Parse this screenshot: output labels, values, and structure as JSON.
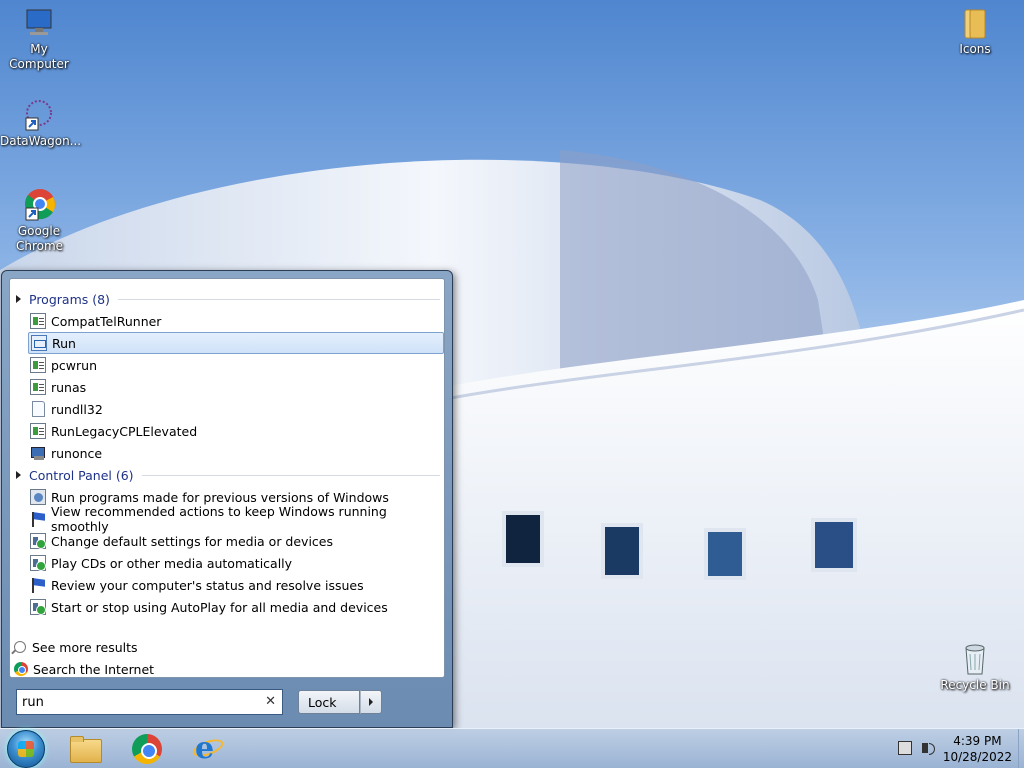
{
  "desktop": {
    "icons": [
      {
        "label": "My Computer"
      },
      {
        "label": "DataWagon..."
      },
      {
        "label": "Google Chrome"
      },
      {
        "label": "Icons"
      },
      {
        "label": "Recycle Bin"
      }
    ]
  },
  "start_menu": {
    "programs_header": "Programs (8)",
    "programs": [
      {
        "label": "CompatTelRunner",
        "icon": "program-icon"
      },
      {
        "label": "Run",
        "icon": "run-icon",
        "selected": true
      },
      {
        "label": "pcwrun",
        "icon": "program-icon"
      },
      {
        "label": "runas",
        "icon": "program-icon"
      },
      {
        "label": "rundll32",
        "icon": "document-icon"
      },
      {
        "label": "RunLegacyCPLElevated",
        "icon": "program-icon"
      },
      {
        "label": "runonce",
        "icon": "runonce-icon"
      }
    ],
    "control_panel_header": "Control Panel (6)",
    "control_panel": [
      {
        "label": "Run programs made for previous versions of Windows",
        "icon": "compatibility-icon"
      },
      {
        "label": "View recommended actions to keep Windows running smoothly",
        "icon": "flag-icon"
      },
      {
        "label": "Change default settings for media or devices",
        "icon": "autoplay-icon"
      },
      {
        "label": "Play CDs or other media automatically",
        "icon": "autoplay-icon"
      },
      {
        "label": "Review your computer's status and resolve issues",
        "icon": "flag-icon"
      },
      {
        "label": "Start or stop using AutoPlay for all media and devices",
        "icon": "autoplay-icon"
      }
    ],
    "see_more": "See more results",
    "search_internet": "Search the Internet",
    "search_value": "run",
    "clear_symbol": "✕",
    "lock_label": "Lock"
  },
  "taskbar": {
    "time": "4:39 PM",
    "date": "10/28/2022"
  }
}
